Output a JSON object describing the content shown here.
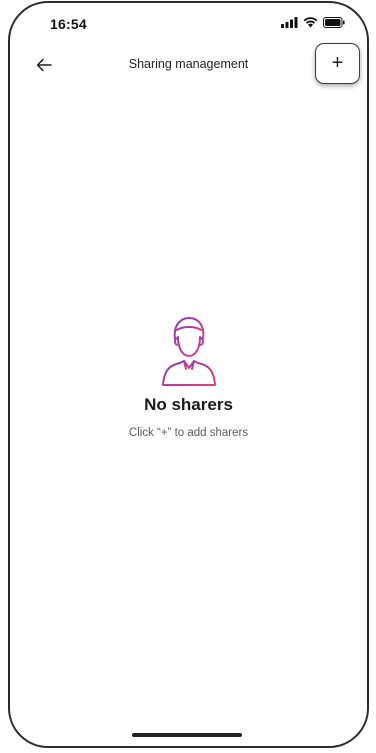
{
  "status_bar": {
    "time": "16:54",
    "icons": [
      "signal-icon",
      "wifi-icon",
      "battery-icon"
    ]
  },
  "header": {
    "title": "Sharing management",
    "back_icon": "arrow-left-icon",
    "add_label": "+"
  },
  "empty_state": {
    "icon": "person-icon",
    "title": "No sharers",
    "hint": "Click “+” to add sharers"
  },
  "colors": {
    "icon_gradient_start": "#7b3fbf",
    "icon_gradient_end": "#e83e7a",
    "text_primary": "#1a1a1a",
    "text_secondary": "#5a5a5a"
  }
}
